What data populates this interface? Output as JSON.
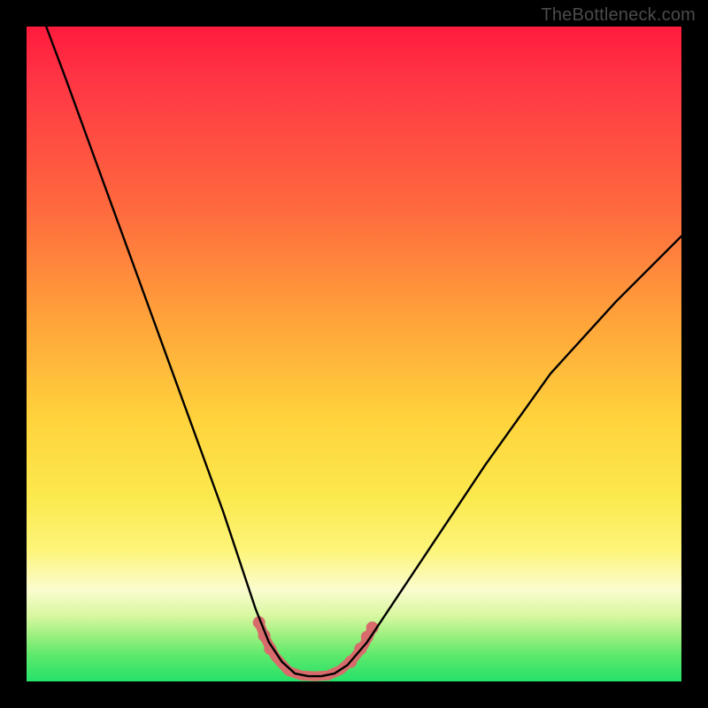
{
  "watermark": "TheBottleneck.com",
  "chart_data": {
    "type": "line",
    "title": "",
    "xlabel": "",
    "ylabel": "",
    "xlim": [
      0,
      100
    ],
    "ylim": [
      0,
      100
    ],
    "gradient_stops": [
      {
        "pos": 0,
        "color": "#ff1a3c"
      },
      {
        "pos": 8,
        "color": "#ff3545"
      },
      {
        "pos": 28,
        "color": "#ff6a3e"
      },
      {
        "pos": 45,
        "color": "#ffa43a"
      },
      {
        "pos": 60,
        "color": "#ffd33c"
      },
      {
        "pos": 72,
        "color": "#fbe94e"
      },
      {
        "pos": 80,
        "color": "#fdf57a"
      },
      {
        "pos": 86,
        "color": "#fbfccf"
      },
      {
        "pos": 90,
        "color": "#d8f7a0"
      },
      {
        "pos": 93,
        "color": "#9cf07f"
      },
      {
        "pos": 96,
        "color": "#5de96c"
      },
      {
        "pos": 100,
        "color": "#25e169"
      }
    ],
    "series": [
      {
        "name": "bottleneck-curve",
        "stroke": "#000000",
        "stroke_width": 2.4,
        "points": [
          {
            "x": 3,
            "y": 100
          },
          {
            "x": 6,
            "y": 92
          },
          {
            "x": 10,
            "y": 81
          },
          {
            "x": 14,
            "y": 70
          },
          {
            "x": 18,
            "y": 59
          },
          {
            "x": 22,
            "y": 48
          },
          {
            "x": 26,
            "y": 37
          },
          {
            "x": 30,
            "y": 26
          },
          {
            "x": 33,
            "y": 17
          },
          {
            "x": 35,
            "y": 11
          },
          {
            "x": 37,
            "y": 6
          },
          {
            "x": 39,
            "y": 3
          },
          {
            "x": 41,
            "y": 1.2
          },
          {
            "x": 43,
            "y": 0.8
          },
          {
            "x": 45,
            "y": 0.8
          },
          {
            "x": 47,
            "y": 1.2
          },
          {
            "x": 49,
            "y": 2.5
          },
          {
            "x": 52,
            "y": 6
          },
          {
            "x": 56,
            "y": 12
          },
          {
            "x": 62,
            "y": 21
          },
          {
            "x": 70,
            "y": 33
          },
          {
            "x": 80,
            "y": 47
          },
          {
            "x": 90,
            "y": 58
          },
          {
            "x": 100,
            "y": 68
          }
        ]
      },
      {
        "name": "trough-highlight",
        "stroke": "#d86b6b",
        "stroke_width": 11,
        "linecap": "round",
        "points": [
          {
            "x": 35.5,
            "y": 9
          },
          {
            "x": 36.5,
            "y": 6.5
          },
          {
            "x": 38,
            "y": 3.8
          },
          {
            "x": 40,
            "y": 1.6
          },
          {
            "x": 42,
            "y": 0.9
          },
          {
            "x": 44,
            "y": 0.8
          },
          {
            "x": 46,
            "y": 0.9
          },
          {
            "x": 48,
            "y": 1.8
          },
          {
            "x": 50,
            "y": 3.6
          },
          {
            "x": 51.5,
            "y": 5.5
          },
          {
            "x": 52.5,
            "y": 7.5
          }
        ]
      }
    ],
    "highlight_dots": {
      "color": "#d86b6b",
      "radius": 7,
      "points": [
        {
          "x": 35.5,
          "y": 9
        },
        {
          "x": 36.3,
          "y": 7.0
        },
        {
          "x": 37.2,
          "y": 5.0
        },
        {
          "x": 49.5,
          "y": 3.0
        },
        {
          "x": 51.0,
          "y": 5.0
        },
        {
          "x": 52.0,
          "y": 6.8
        },
        {
          "x": 52.8,
          "y": 8.2
        }
      ]
    }
  }
}
